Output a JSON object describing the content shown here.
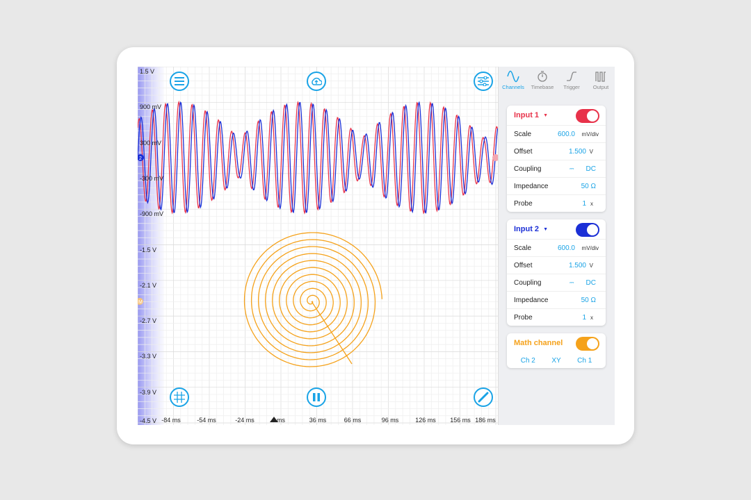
{
  "scope": {
    "y_axis_labels": [
      "1.5 V",
      "900 mV",
      "300 mV",
      "-300 mV",
      "-900 mV",
      "-1.5 V",
      "-2.1 V",
      "-2.7 V",
      "-3.3 V",
      "-3.9 V",
      "-4.5 V"
    ],
    "x_axis_labels": [
      "-84 ms",
      "-54 ms",
      "-24 ms",
      "ms",
      "36 ms",
      "66 ms",
      "96 ms",
      "126 ms",
      "156 ms",
      "186 ms"
    ],
    "trace_colors": {
      "input1": "#e8324a",
      "input2": "#1b2fd6",
      "math": "#f5a21b"
    },
    "toolbar_icons": {
      "menu": "menu-icon",
      "cloud": "cloud-upload-icon",
      "settings": "sliders-icon",
      "grid": "grid-icon",
      "pause": "pause-icon",
      "ruler": "measure-icon"
    }
  },
  "tabs": [
    {
      "label": "Channels",
      "icon": "sine-wave-icon",
      "active": true
    },
    {
      "label": "Timebase",
      "icon": "stopwatch-icon",
      "active": false
    },
    {
      "label": "Trigger",
      "icon": "trigger-edge-icon",
      "active": false
    },
    {
      "label": "Output",
      "icon": "pulse-output-icon",
      "active": false
    }
  ],
  "input1": {
    "title": "Input 1",
    "color": "#e8324a",
    "enabled": true,
    "rows": [
      {
        "label": "Scale",
        "value": "600.0",
        "unit": "mV/div"
      },
      {
        "label": "Offset",
        "value": "1.500",
        "unit": "V"
      },
      {
        "label": "Coupling",
        "value": "DC",
        "unit": ""
      },
      {
        "label": "Impedance",
        "value": "50 Ω",
        "unit": ""
      },
      {
        "label": "Probe",
        "value": "1",
        "unit": "x"
      }
    ]
  },
  "input2": {
    "title": "Input 2",
    "color": "#1b2fd6",
    "enabled": true,
    "rows": [
      {
        "label": "Scale",
        "value": "600.0",
        "unit": "mV/div"
      },
      {
        "label": "Offset",
        "value": "1.500",
        "unit": "V"
      },
      {
        "label": "Coupling",
        "value": "DC",
        "unit": ""
      },
      {
        "label": "Impedance",
        "value": "50 Ω",
        "unit": ""
      },
      {
        "label": "Probe",
        "value": "1",
        "unit": "x"
      }
    ]
  },
  "math": {
    "title": "Math channel",
    "color": "#f5a21b",
    "enabled": true,
    "options": [
      "Ch 2",
      "XY",
      "Ch 1"
    ]
  },
  "accent_color": "#19a3e6"
}
